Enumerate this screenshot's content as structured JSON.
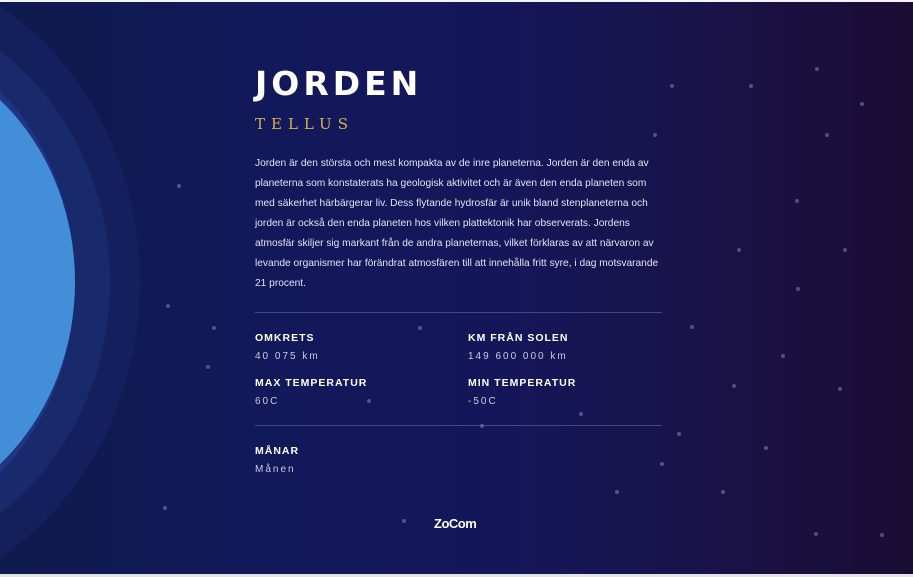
{
  "planet": {
    "name": "JORDEN",
    "latin_name": "TELLUS",
    "description": "Jorden är den största och mest kompakta av de inre planeterna. Jorden är den enda av planeterna som konstaterats ha geologisk aktivitet och är även den enda planeten som med säkerhet härbärgerar liv. Dess flytande hydrosfär är unik bland stenplaneterna och jorden är också den enda planeten hos vilken plattektonik har observerats. Jordens atmosfär skiljer sig markant från de andra planeternas, vilket förklaras av att närvaron av levande organismer har förändrat atmosfären till att innehålla fritt syre, i dag motsvarande 21 procent.",
    "color": "#428ed9"
  },
  "stats": {
    "circumference": {
      "label": "OMKRETS",
      "value": "40 075 km"
    },
    "distance": {
      "label": "KM FRÅN SOLEN",
      "value": "149 600 000 km"
    },
    "max_temp": {
      "label": "MAX TEMPERATUR",
      "value": "60C"
    },
    "min_temp": {
      "label": "MIN TEMPERATUR",
      "value": "-50C"
    }
  },
  "moons": {
    "label": "MÅNAR",
    "value": "Månen"
  },
  "brand": {
    "logo_text": "ZoCom"
  },
  "colors": {
    "background": "#12195a",
    "accent": "#d9b14a",
    "text": "#ffffff"
  }
}
